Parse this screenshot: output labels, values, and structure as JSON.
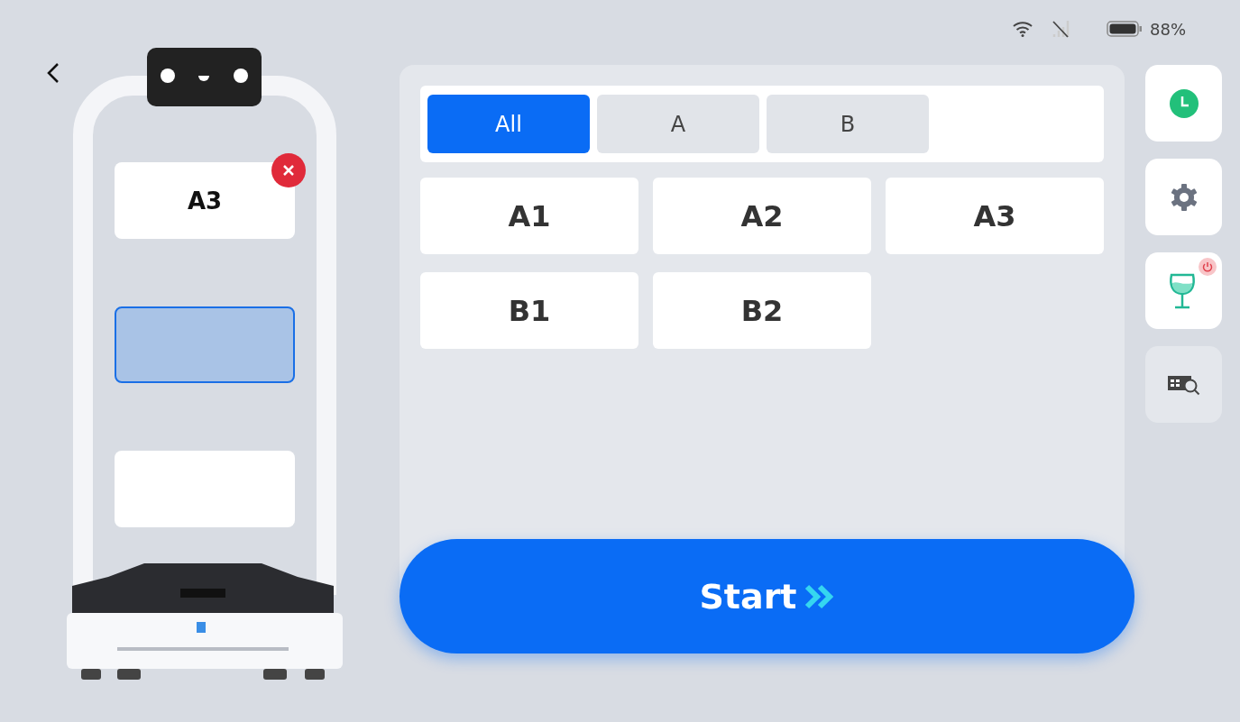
{
  "status_bar": {
    "battery": "88%"
  },
  "trays": [
    {
      "table": "A3",
      "selected": false
    },
    {
      "selected": true
    },
    {
      "selected": false
    }
  ],
  "tabs": [
    {
      "label": "All",
      "selected": true
    },
    {
      "label": "A",
      "selected": false
    },
    {
      "label": "B",
      "selected": false
    }
  ],
  "tables": [
    {
      "label": "A1"
    },
    {
      "label": "A2"
    },
    {
      "label": "A3"
    },
    {
      "label": "B1"
    },
    {
      "label": "B2"
    }
  ],
  "start_button": {
    "label": "Start"
  },
  "side_buttons": [
    {
      "kind": "timer",
      "disabled": false
    },
    {
      "kind": "settings",
      "disabled": false
    },
    {
      "kind": "glass",
      "disabled": false
    },
    {
      "kind": "table-search",
      "disabled": true
    }
  ]
}
